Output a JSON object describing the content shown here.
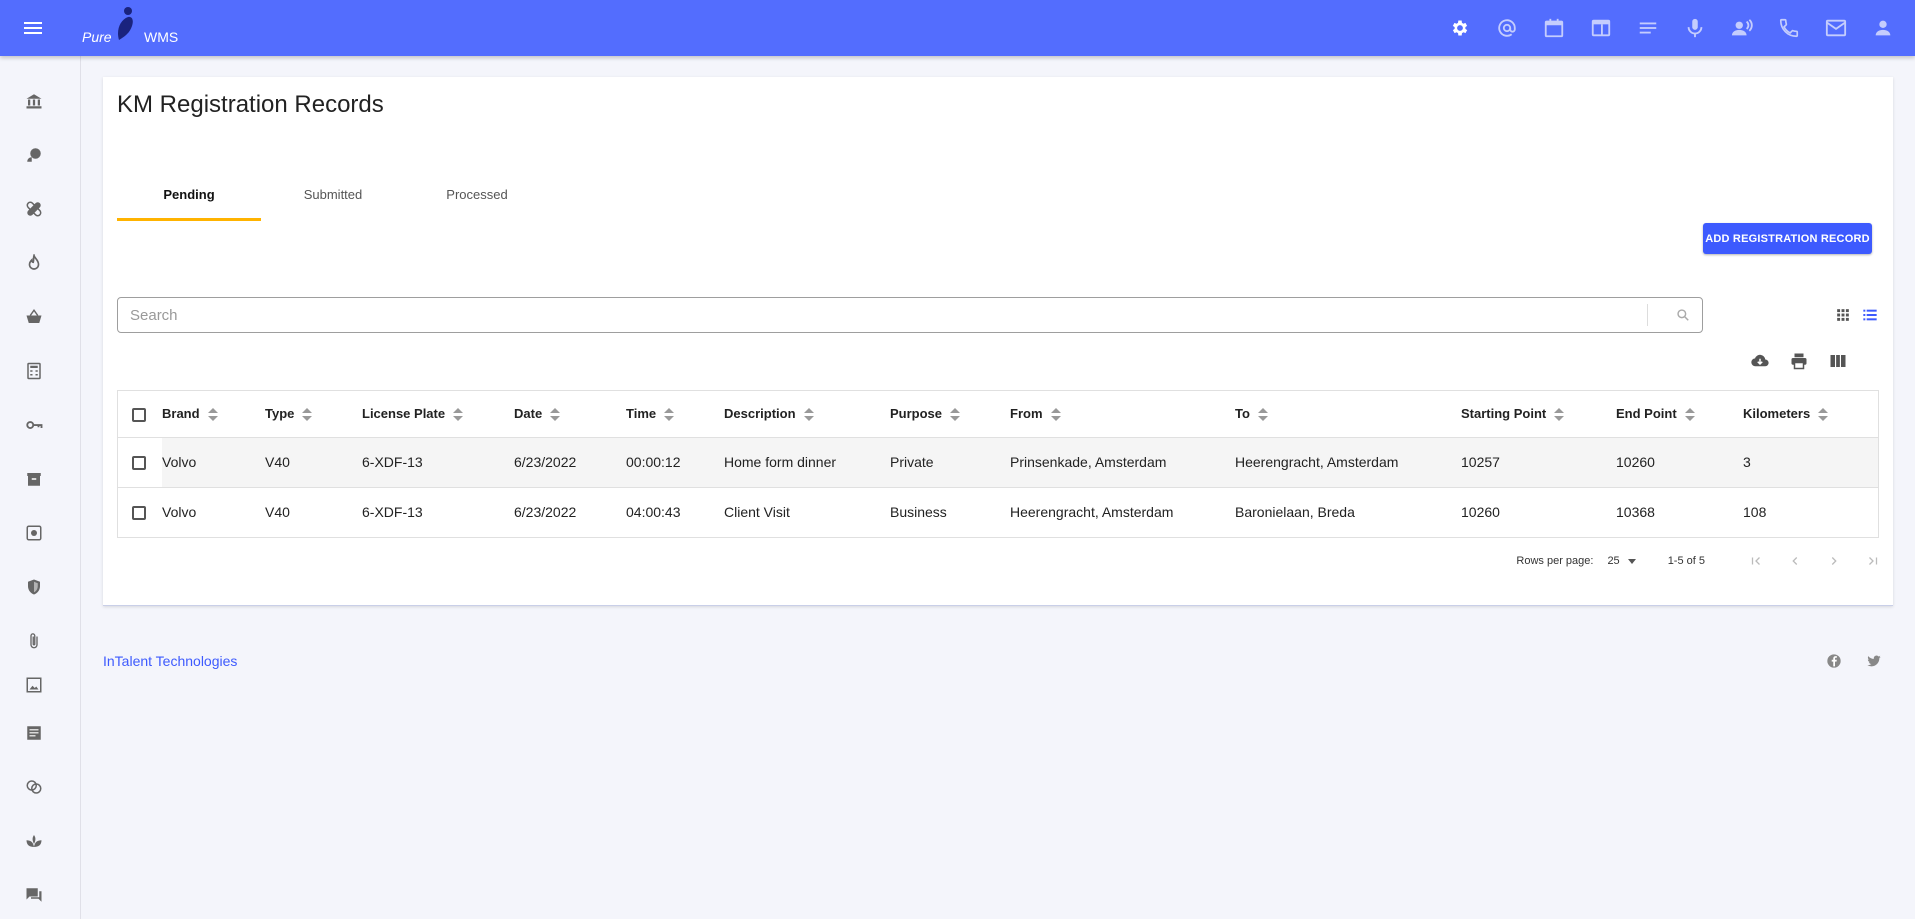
{
  "header": {
    "brand_pure": "Pure",
    "brand_wms": "WMS",
    "icons": [
      "settings-icon",
      "at-icon",
      "calendar-icon",
      "browser-icon",
      "notes-icon",
      "mic-icon",
      "voice-icon",
      "phone-icon",
      "mail-icon",
      "user-icon"
    ]
  },
  "sidebar": {
    "icons": [
      "bank-icon",
      "palette-icon",
      "healing-icon",
      "flame-icon",
      "basket-icon",
      "calculator-icon",
      "key-icon",
      "archive-icon",
      "currency-icon",
      "shield-icon",
      "attachment-icon",
      "image-frame-icon",
      "document-icon",
      "chat-circles-icon",
      "spa-icon",
      "forum-icon"
    ]
  },
  "page": {
    "title": "KM Registration Records",
    "tabs": [
      {
        "label": "Pending",
        "active": true
      },
      {
        "label": "Submitted",
        "active": false
      },
      {
        "label": "Processed",
        "active": false
      }
    ],
    "add_button": "ADD REGISTRATION RECORD",
    "search_placeholder": "Search"
  },
  "table": {
    "columns": [
      "Brand",
      "Type",
      "License Plate",
      "Date",
      "Time",
      "Description",
      "Purpose",
      "From",
      "To",
      "Starting Point",
      "End Point",
      "Kilometers"
    ],
    "rows": [
      [
        "Volvo",
        "V40",
        "6-XDF-13",
        "6/23/2022",
        "00:00:12",
        "Home form dinner",
        "Private",
        "Prinsenkade, Amsterdam",
        "Heerengracht, Amsterdam",
        "10257",
        "10260",
        "3"
      ],
      [
        "Volvo",
        "V40",
        "6-XDF-13",
        "6/23/2022",
        "04:00:43",
        "Client Visit",
        "Business",
        "Heerengracht, Amsterdam",
        "Baronielaan, Breda",
        "10260",
        "10368",
        "108"
      ]
    ]
  },
  "pagination": {
    "rows_per_page_label": "Rows per page:",
    "rows_per_page": "25",
    "range": "1-5 of 5"
  },
  "footer": {
    "company": "InTalent Technologies"
  },
  "colors": {
    "primary": "#536dfe",
    "button": "#3d5afe",
    "tab_indicator": "#ffb300"
  }
}
